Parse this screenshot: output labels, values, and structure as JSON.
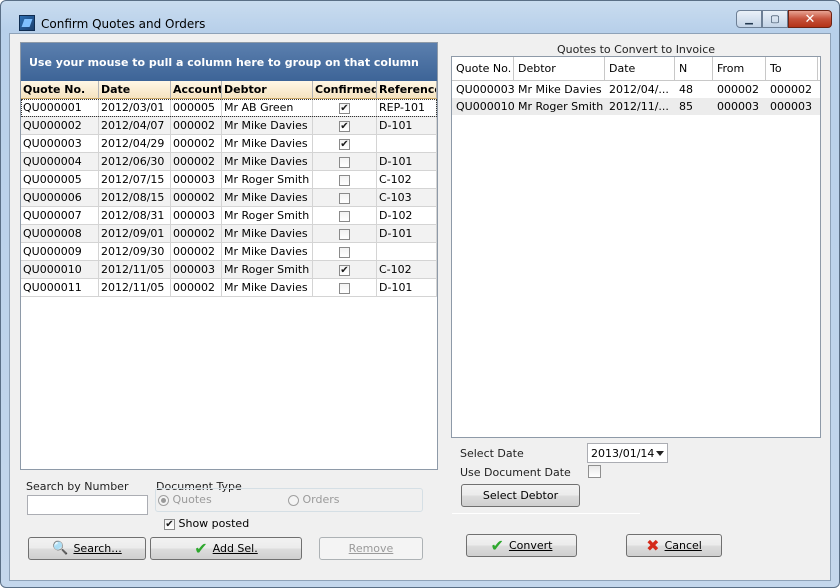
{
  "window": {
    "title": "Confirm Quotes and Orders"
  },
  "left_grid": {
    "group_banner": "Use your mouse to pull a column here to group on that column",
    "headers": [
      "Quote No.",
      "Date",
      "Account",
      "Debtor",
      "Confirmed",
      "Reference"
    ],
    "rows": [
      [
        "QU000001",
        "2012/03/01",
        "000005",
        "Mr AB Green",
        true,
        "REP-101"
      ],
      [
        "QU000002",
        "2012/04/07",
        "000002",
        "Mr Mike Davies",
        true,
        "D-101"
      ],
      [
        "QU000003",
        "2012/04/29",
        "000002",
        "Mr Mike Davies",
        true,
        ""
      ],
      [
        "QU000004",
        "2012/06/30",
        "000002",
        "Mr Mike Davies",
        false,
        "D-101"
      ],
      [
        "QU000005",
        "2012/07/15",
        "000003",
        "Mr Roger Smith",
        false,
        "C-102"
      ],
      [
        "QU000006",
        "2012/08/15",
        "000002",
        "Mr Mike Davies",
        false,
        "C-103"
      ],
      [
        "QU000007",
        "2012/08/31",
        "000003",
        "Mr Roger Smith",
        false,
        "D-102"
      ],
      [
        "QU000008",
        "2012/09/01",
        "000002",
        "Mr Mike Davies",
        false,
        "D-101"
      ],
      [
        "QU000009",
        "2012/09/30",
        "000002",
        "Mr Mike Davies",
        false,
        ""
      ],
      [
        "QU000010",
        "2012/11/05",
        "000003",
        "Mr Roger Smith",
        true,
        "C-102"
      ],
      [
        "QU000011",
        "2012/11/05",
        "000002",
        "Mr Mike Davies",
        false,
        "D-101"
      ]
    ]
  },
  "search": {
    "label": "Search by Number",
    "value": ""
  },
  "document_type": {
    "label": "Document Type",
    "option_quotes": "Quotes",
    "option_orders": "Orders"
  },
  "show_posted": {
    "label": "Show posted",
    "checked": true
  },
  "buttons": {
    "search": "Search...",
    "add_sel": "Add Sel.",
    "remove": "Remove",
    "select_debtor": "Select Debtor",
    "convert": "Convert",
    "cancel": "Cancel"
  },
  "right_grid": {
    "title": "Quotes to Convert to Invoice",
    "headers": [
      "Quote No.",
      "Debtor",
      "Date",
      "N",
      "From",
      "To"
    ],
    "rows": [
      [
        "QU000003",
        "Mr Mike Davies",
        "2012/04/...",
        "48",
        "000002",
        "000002"
      ],
      [
        "QU000010",
        "Mr Roger Smith",
        "2012/11/...",
        "85",
        "000003",
        "000003"
      ]
    ]
  },
  "select_date": {
    "label": "Select Date",
    "value": "2013/01/14"
  },
  "use_document_date": {
    "label": "Use Document Date",
    "checked": false
  },
  "colors": {
    "banner": "#3d6497",
    "header_bg": "#f5e3c0",
    "close": "#c6513a"
  }
}
